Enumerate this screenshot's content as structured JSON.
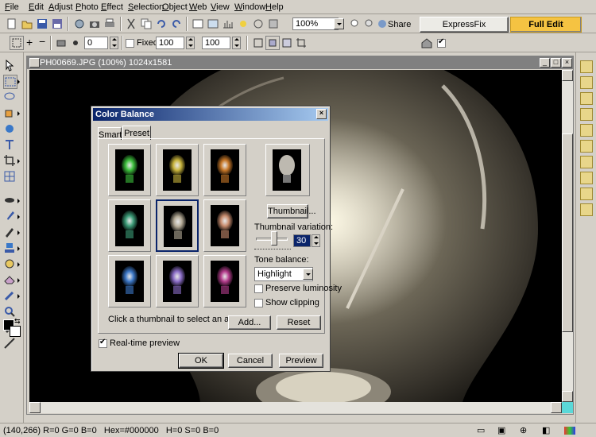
{
  "menu": [
    "File",
    "Edit",
    "Adjust",
    "Photo",
    "Effect",
    "Selection",
    "Object",
    "Web",
    "View",
    "Window",
    "Help"
  ],
  "toolbar": {
    "zoom_value": "100%",
    "share_label": "Share",
    "expressfix_label": "ExpressFix",
    "fulledit_label": "Full Edit"
  },
  "attributes": {
    "rotation_value": "0",
    "fixed_label": "Fixed",
    "width_value": "100",
    "height_value": "100"
  },
  "image_window": {
    "title": "PH00669.JPG (100%) 1024x1581"
  },
  "dialog": {
    "title": "Color Balance",
    "tabs": [
      "Smart",
      "Preset"
    ],
    "active_tab": "Preset",
    "thumbnail_button": "Thumbnail...",
    "thumbnail_variation_label": "Thumbnail variation:",
    "variation_value": "30",
    "tone_balance_label": "Tone balance:",
    "tone_balance_value": "Highlight",
    "preserve_luminosity_label": "Preserve luminosity",
    "show_clipping_label": "Show clipping",
    "hint": "Click a thumbnail to select an adjustment.",
    "add_button": "Add...",
    "reset_button": "Reset",
    "realtime_label": "Real-time preview",
    "ok_button": "OK",
    "cancel_button": "Cancel",
    "preview_button": "Preview",
    "thumb_colors": [
      "#3cbf3c",
      "#c8b43c",
      "#c87828",
      "#3c9c78",
      "#b4aa96",
      "#c88c6e",
      "#3c78c8",
      "#8c6ec8",
      "#b43c8c"
    ],
    "preview_color": "#d2cdc3"
  },
  "status": {
    "text": "(140,266) R=0 G=0 B=0   Hex=#000000   H=0 S=0 B=0"
  },
  "colors": {
    "accent": "#f5c342",
    "title_bar": "#0a246a"
  }
}
